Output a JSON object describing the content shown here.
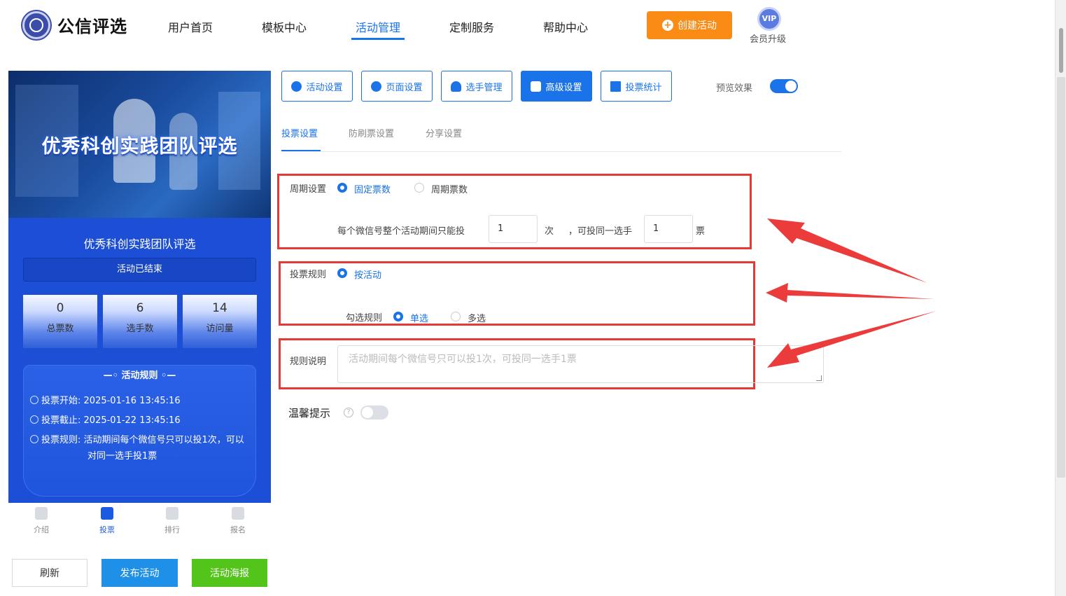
{
  "header": {
    "logo_text": "公信评选",
    "nav": [
      "用户首页",
      "模板中心",
      "活动管理",
      "定制服务",
      "帮助中心"
    ],
    "active_nav": "活动管理",
    "create_button": "创建活动",
    "vip_badge": "VIP",
    "vip_label": "会员升级"
  },
  "preview": {
    "banner_title": "优秀科创实践团队评选",
    "activity_title": "优秀科创实践团队评选",
    "status": "活动已结束",
    "stats": [
      {
        "value": "0",
        "label": "总票数"
      },
      {
        "value": "6",
        "label": "选手数"
      },
      {
        "value": "14",
        "label": "访问量"
      }
    ],
    "rules_heading": "活动规则",
    "rules": {
      "start_label": "投票开始:",
      "start_value": "2025-01-16 13:45:16",
      "end_label": "投票截止:",
      "end_value": "2025-01-22 13:45:16",
      "rule_label": "投票规则:",
      "rule_value": "活动期间每个微信号只可以投1次，可以",
      "rule_value_2": "对同一选手投1票"
    },
    "bottom_nav": [
      "介绍",
      "投票",
      "排行",
      "报名"
    ],
    "active_bottom_nav": "投票"
  },
  "buttons": {
    "refresh": "刷新",
    "publish": "发布活动",
    "poster": "活动海报"
  },
  "tabs": [
    "活动设置",
    "页面设置",
    "选手管理",
    "高级设置",
    "投票统计"
  ],
  "active_tab": "高级设置",
  "preview_toggle_label": "预览效果",
  "preview_toggle_on": true,
  "subtabs": [
    "投票设置",
    "防刷票设置",
    "分享设置"
  ],
  "active_subtab": "投票设置",
  "period": {
    "label": "周期设置",
    "option_fixed": "固定票数",
    "option_cycle": "周期票数",
    "selected": "固定票数",
    "text_prefix": "每个微信号整个活动期间只能投",
    "times_value": "1",
    "times_unit": "次",
    "text_mid": "，可投同一选手",
    "votes_value": "1",
    "votes_unit": "票"
  },
  "vote_rule": {
    "label": "投票规则",
    "option": "按活动",
    "check_label": "勾选规则",
    "single": "单选",
    "multi": "多选",
    "selected": "单选"
  },
  "rule_desc": {
    "label": "规则说明",
    "placeholder": "活动期间每个微信号只可以投1次，可投同一选手1票"
  },
  "tips": {
    "label": "温馨提示",
    "help": "?",
    "enabled": false
  },
  "colors": {
    "accent": "#1a73e8",
    "orange": "#fa8c16",
    "green": "#52c41a",
    "annotation_red": "#e53935"
  }
}
